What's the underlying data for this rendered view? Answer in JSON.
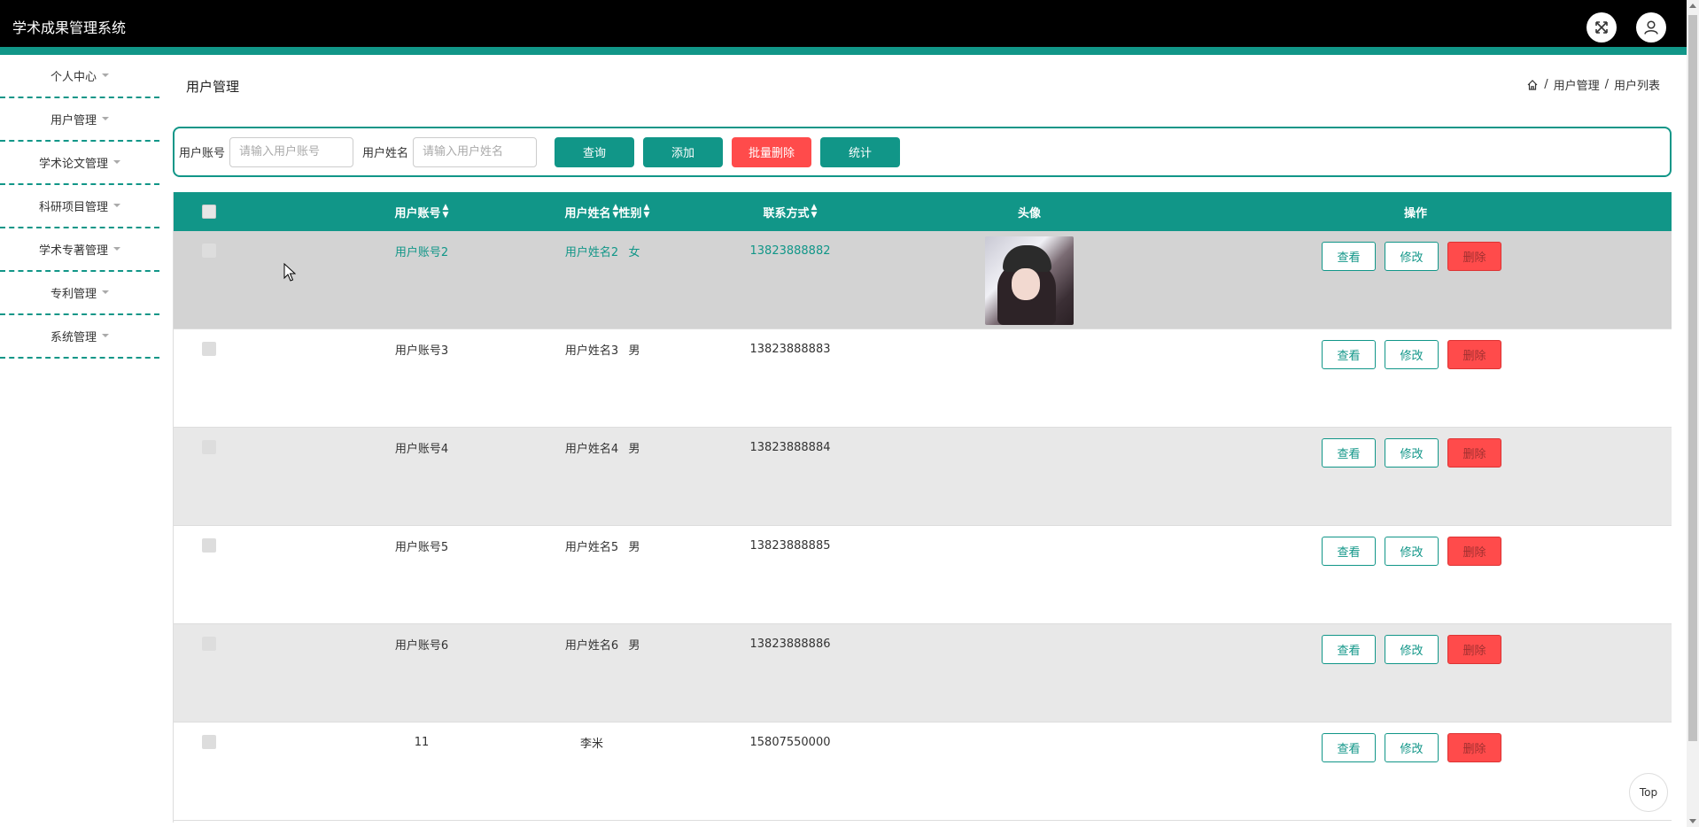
{
  "app": {
    "title": "学术成果管理系统"
  },
  "sidebar": {
    "items": [
      {
        "label": "个人中心"
      },
      {
        "label": "用户管理"
      },
      {
        "label": "学术论文管理"
      },
      {
        "label": "科研项目管理"
      },
      {
        "label": "学术专著管理"
      },
      {
        "label": "专利管理"
      },
      {
        "label": "系统管理"
      }
    ]
  },
  "page": {
    "title": "用户管理",
    "breadcrumb": [
      "用户管理",
      "用户列表"
    ],
    "breadcrumb_separator": "/"
  },
  "search": {
    "account_label": "用户账号",
    "account_placeholder": "请输入用户账号",
    "name_label": "用户姓名",
    "name_placeholder": "请输入用户姓名",
    "query_button": "查询",
    "add_button": "添加",
    "batch_delete_button": "批量删除",
    "stats_button": "统计"
  },
  "table": {
    "headers": {
      "account": "用户账号",
      "name": "用户姓名",
      "sex": "性别",
      "phone": "联系方式",
      "avatar": "头像",
      "ops": "操作"
    },
    "rows": [
      {
        "account": "用户账号2",
        "name": "用户姓名2",
        "sex": "女",
        "phone": "13823888882",
        "has_avatar": true
      },
      {
        "account": "用户账号3",
        "name": "用户姓名3",
        "sex": "男",
        "phone": "13823888883"
      },
      {
        "account": "用户账号4",
        "name": "用户姓名4",
        "sex": "男",
        "phone": "13823888884"
      },
      {
        "account": "用户账号5",
        "name": "用户姓名5",
        "sex": "男",
        "phone": "13823888885"
      },
      {
        "account": "用户账号6",
        "name": "用户姓名6",
        "sex": "男",
        "phone": "13823888886"
      },
      {
        "account": "11",
        "name": "李米",
        "sex": "",
        "phone": "15807550000"
      }
    ],
    "row_actions": {
      "view": "查看",
      "edit": "修改",
      "delete": "删除"
    }
  },
  "top_button": "Top",
  "colors": {
    "accent": "#119688",
    "danger": "#ff4b4b",
    "header_bg": "#000000"
  }
}
